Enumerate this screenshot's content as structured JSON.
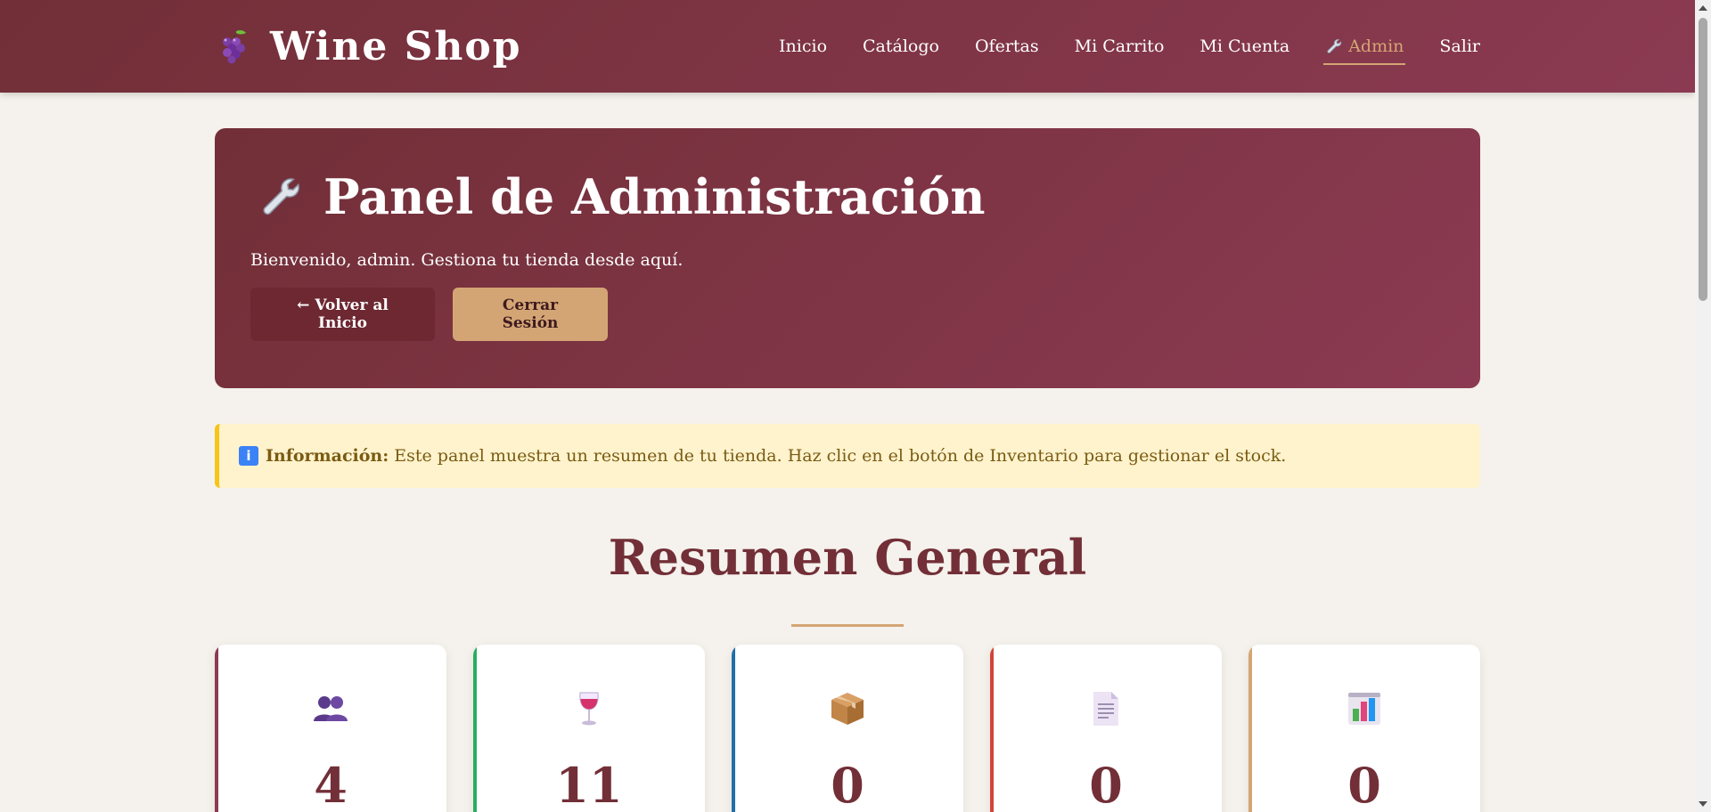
{
  "header": {
    "brand_name": "Wine Shop",
    "brand_icon": "grapes-icon",
    "nav": [
      {
        "label": "Inicio",
        "active": false
      },
      {
        "label": "Catálogo",
        "active": false
      },
      {
        "label": "Ofertas",
        "active": false
      },
      {
        "label": "Mi Carrito",
        "active": false
      },
      {
        "label": "Mi Cuenta",
        "active": false
      },
      {
        "label": "Admin",
        "active": true,
        "icon": "wrench-icon"
      },
      {
        "label": "Salir",
        "active": false
      }
    ]
  },
  "hero": {
    "icon": "wrench-icon",
    "title": "Panel de Administración",
    "subtitle": "Bienvenido, admin. Gestiona tu tienda desde aquí.",
    "back_label": "← Volver al Inicio",
    "logout_label": "Cerrar Sesión"
  },
  "alert": {
    "icon": "info-icon",
    "label": "Información:",
    "text": "Este panel muestra un resumen de tu tienda. Haz clic en el botón de Inventario para gestionar el stock."
  },
  "summary": {
    "title": "Resumen General",
    "cards": [
      {
        "icon": "users-icon",
        "value": "4",
        "accent": "#8b3a52"
      },
      {
        "icon": "wine-glass-icon",
        "value": "11",
        "accent": "#27ae60"
      },
      {
        "icon": "package-icon",
        "value": "0",
        "accent": "#1f6fa8"
      },
      {
        "icon": "document-icon",
        "value": "0",
        "accent": "#d0453a"
      },
      {
        "icon": "bar-chart-icon",
        "value": "0",
        "accent": "#d4a574"
      }
    ]
  },
  "colors": {
    "primary": "#722f37",
    "primary_light": "#8b3a52",
    "gold": "#d4a574",
    "background": "#f5f1ec",
    "alert_bg": "#fff3cd"
  }
}
